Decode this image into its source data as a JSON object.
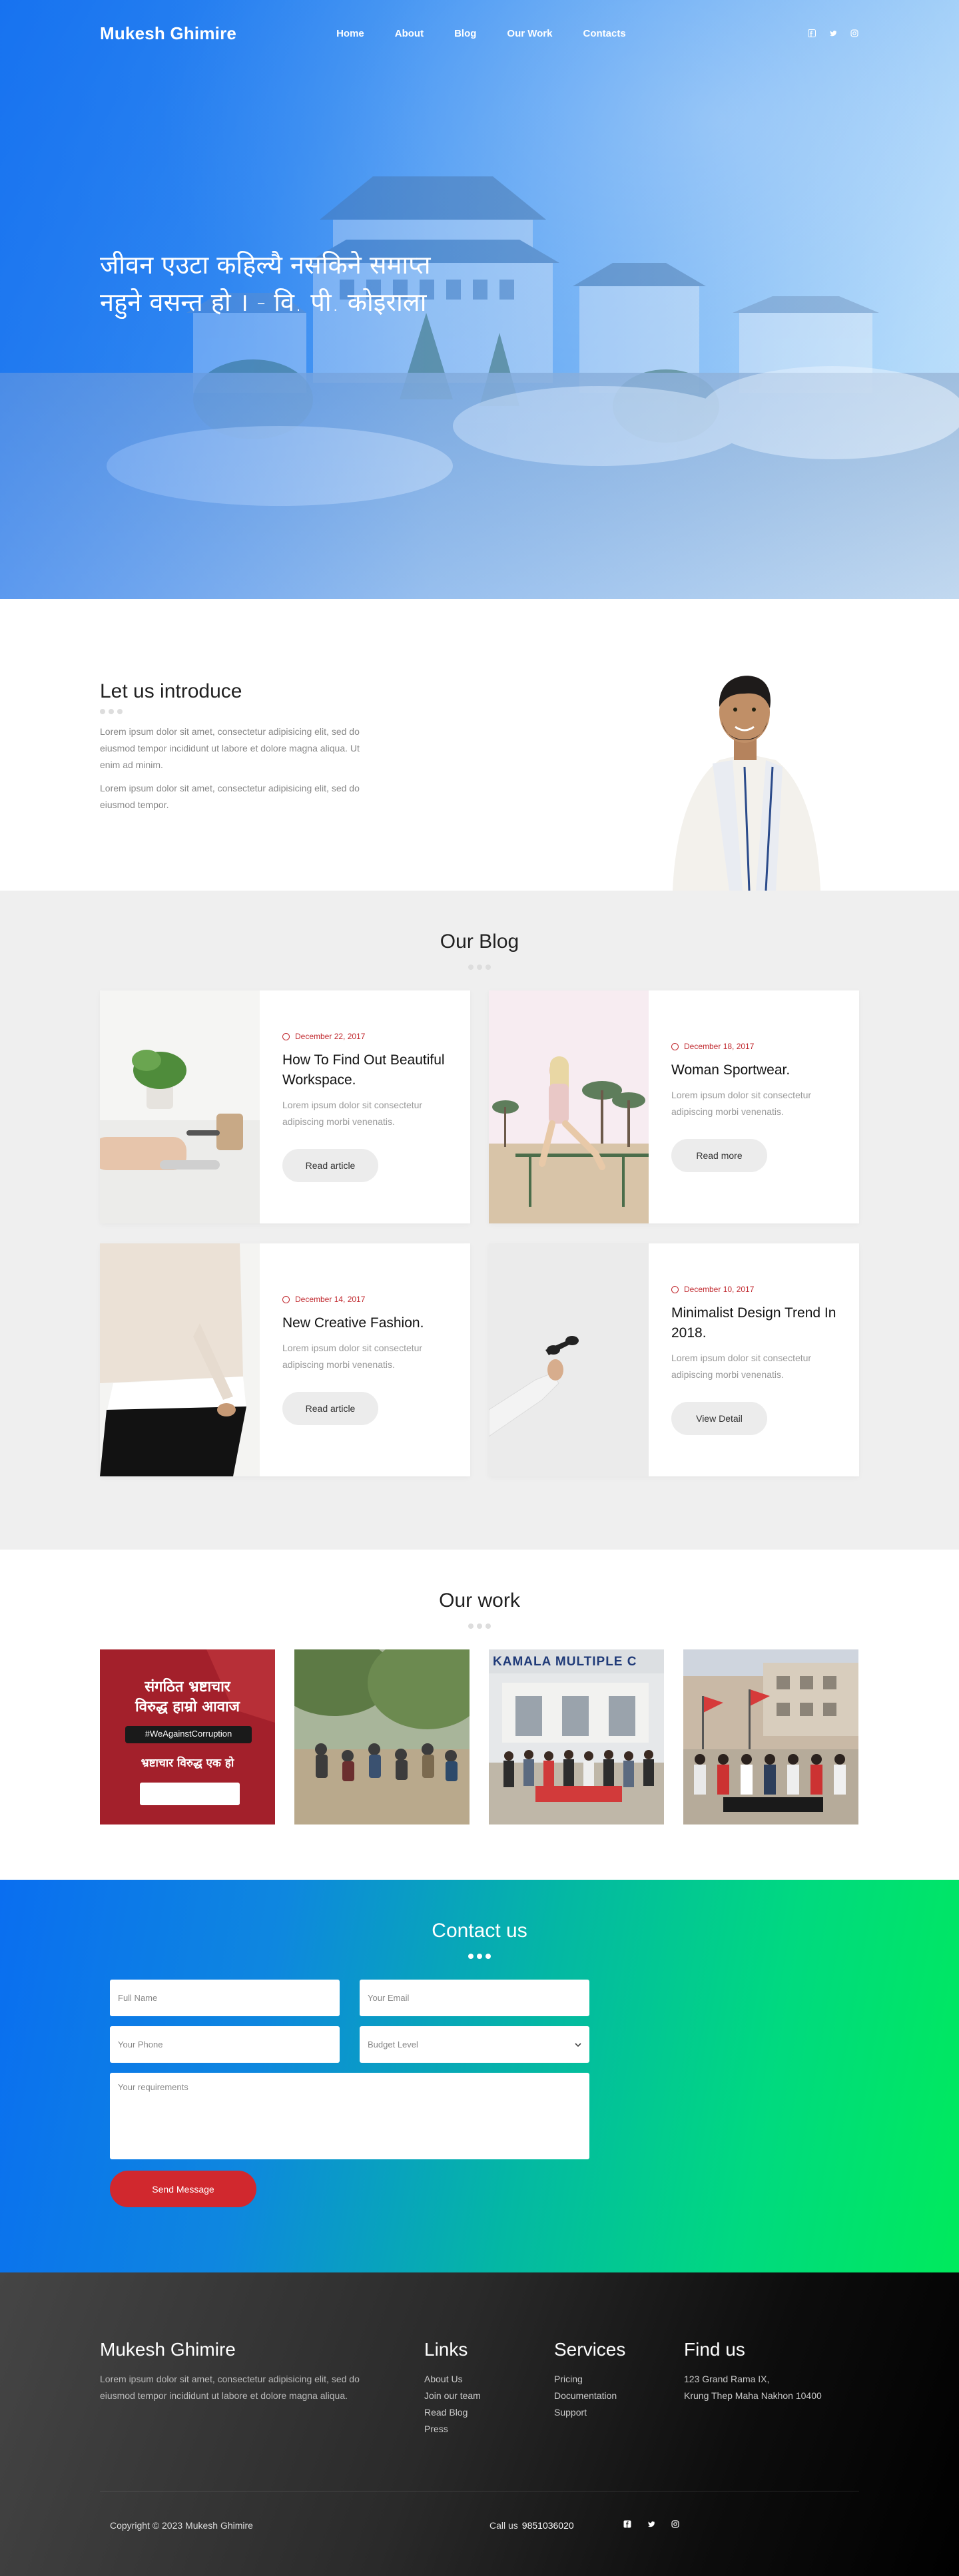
{
  "nav": {
    "brand": "Mukesh Ghimire",
    "items": [
      "Home",
      "About",
      "Blog",
      "Our Work",
      "Contacts"
    ],
    "social_icons": [
      "facebook-icon",
      "twitter-icon",
      "instagram-icon"
    ]
  },
  "hero": {
    "quote": "जीवन एउटा कहिल्यै नसकिने समाप्त नहुने वसन्त हो । - वि. पी. कोइराला"
  },
  "intro": {
    "title": "Let us introduce",
    "p1": "Lorem ipsum dolor sit amet, consectetur adipisicing elit, sed do eiusmod tempor incididunt ut labore et dolore magna aliqua. Ut enim ad minim.",
    "p2": "Lorem ipsum dolor sit amet, consectetur adipisicing elit, sed do eiusmod tempor."
  },
  "blog": {
    "title": "Our Blog",
    "cards": [
      {
        "date": "December 22, 2017",
        "title": "How To Find Out Beautiful Workspace.",
        "excerpt": "Lorem ipsum dolor sit consectetur adipiscing morbi venenatis.",
        "button": "Read article"
      },
      {
        "date": "December 18, 2017",
        "title": "Woman Sportwear.",
        "excerpt": "Lorem ipsum dolor sit consectetur adipiscing morbi venenatis.",
        "button": "Read more"
      },
      {
        "date": "December 14, 2017",
        "title": "New Creative Fashion.",
        "excerpt": "Lorem ipsum dolor sit consectetur adipiscing morbi venenatis.",
        "button": "Read article"
      },
      {
        "date": "December 10, 2017",
        "title": "Minimalist Design Trend In 2018.",
        "excerpt": "Lorem ipsum dolor sit consectetur adipiscing morbi venenatis.",
        "button": "View Detail"
      }
    ]
  },
  "work": {
    "title": "Our work",
    "poster": {
      "line1": "संगठित भ्रष्टाचार",
      "line2": "विरुद्ध हाम्रो आवाज",
      "hashtag": "#WeAgainstCorruption",
      "line3": "भ्रष्टाचार विरुद्ध एक हो"
    },
    "college_sign": "KAMALA MULTIPLE C"
  },
  "contact": {
    "title": "Contact us",
    "full_name": "Full Name",
    "email": "Your Email",
    "phone": "Your Phone",
    "budget": "Budget Level",
    "requirements": "Your requirements",
    "send": "Send Message"
  },
  "footer": {
    "brand": "Mukesh Ghimire",
    "about": "Lorem ipsum dolor sit amet, consectetur adipisicing elit, sed do eiusmod tempor incididunt ut labore et dolore magna aliqua.",
    "links_title": "Links",
    "links": [
      "About Us",
      "Join our team",
      "Read Blog",
      "Press"
    ],
    "services_title": "Services",
    "services": [
      "Pricing",
      "Documentation",
      "Support"
    ],
    "find_title": "Find us",
    "address": [
      "123 Grand Rama IX,",
      "Krung Thep Maha Nakhon 10400"
    ],
    "copyright": "Copyright © 2023 Mukesh Ghimire",
    "call_label": "Call us",
    "phone": "9851036020"
  },
  "colors": {
    "accent_red": "#d1282e",
    "date_red": "#c0272d",
    "hero_blue": "#1a78ef",
    "contact_green": "#00ea5c"
  }
}
